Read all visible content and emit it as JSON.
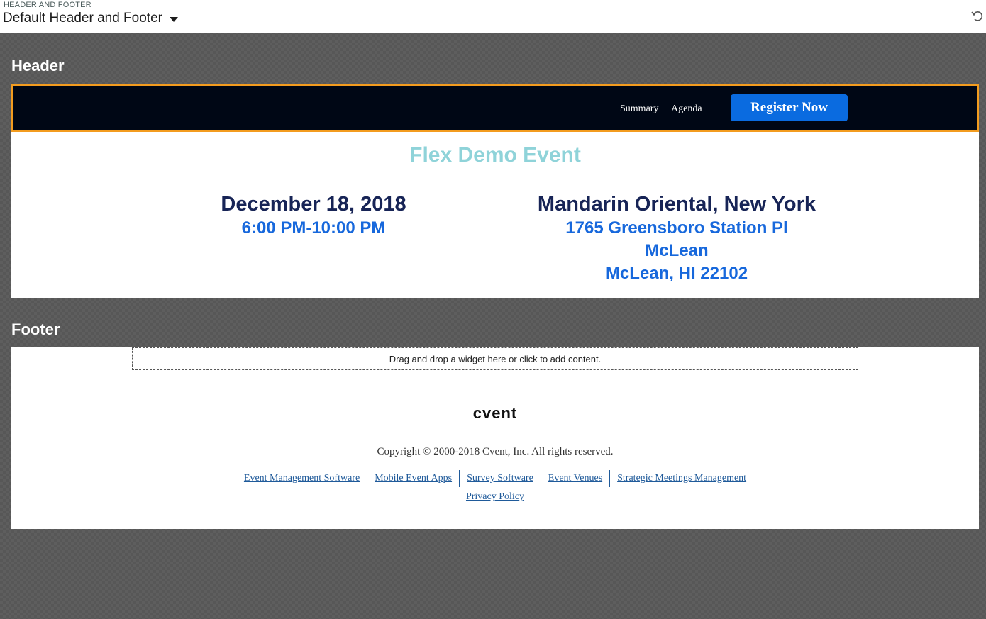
{
  "topbar": {
    "section_label": "HEADER AND FOOTER",
    "selected": "Default Header and Footer"
  },
  "header_section": {
    "title": "Header",
    "nav": [
      "Summary",
      "Agenda"
    ],
    "register_label": "Register Now",
    "event_title": "Flex Demo Event",
    "date": "December 18, 2018",
    "time": "6:00 PM-10:00 PM",
    "venue": "Mandarin Oriental, New York",
    "address_line1": "1765 Greensboro Station Pl",
    "address_line2": "McLean",
    "address_line3": "McLean, HI 22102"
  },
  "footer_section": {
    "title": "Footer",
    "dropzone_text": "Drag and drop a widget here or click to add content.",
    "logo": "cvent",
    "copyright": "Copyright © 2000-2018 Cvent, Inc. All rights reserved.",
    "links": [
      "Event Management Software",
      "Mobile Event Apps",
      "Survey Software",
      "Event Venues",
      "Strategic Meetings Management"
    ],
    "privacy": "Privacy Policy"
  },
  "colors": {
    "header_bar": "#000715",
    "header_border": "#f39c1f",
    "register_button": "#0a6be0",
    "event_title": "#8fd3d9",
    "date_text": "#172456",
    "detail_text": "#1768dc"
  },
  "icons": {
    "dropdown": "caret-down-icon",
    "undo": "undo-icon"
  }
}
